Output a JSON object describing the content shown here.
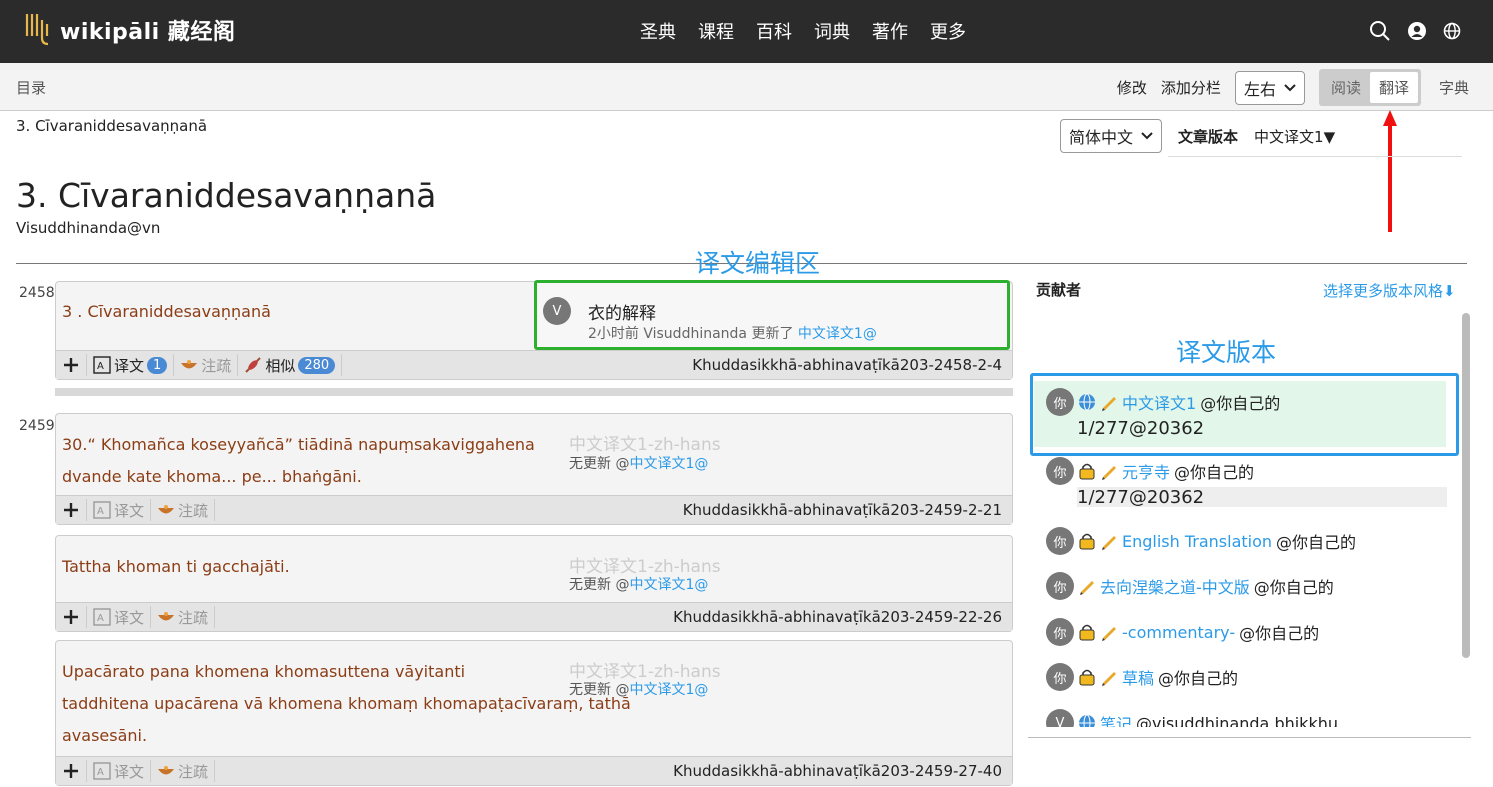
{
  "app": {
    "logo": "wikipāli 藏经阁",
    "nav": [
      "圣典",
      "课程",
      "百科",
      "词典",
      "著作",
      "更多"
    ]
  },
  "toolbar": {
    "toc": "目录",
    "edit": "修改",
    "add_column": "添加分栏",
    "layout": "左右",
    "mode_read": "阅读",
    "mode_translate": "翻译",
    "dict": "字典"
  },
  "page": {
    "crumb": "3. Cīvaraniddesavaṇṇanā",
    "lang": "简体中文",
    "version_label": "文章版本",
    "version_value": "中文译文1▼",
    "title": "3. Cīvaraniddesavaṇṇanā",
    "author": "Visuddhinanda@vn"
  },
  "annotations": {
    "edit_area": "译文编辑区",
    "versions": "译文版本"
  },
  "paragraphs": [
    {
      "num": "2458",
      "pali": "3 . Cīvaraniddesavaṇṇanā",
      "trans_avatar": "V",
      "trans_text": "衣的解释",
      "trans_meta": "2小时前 Visuddhinanda 更新了",
      "trans_link": "中文译文1@",
      "plus": "",
      "tr": "译文",
      "tr_count": "1",
      "note": "注疏",
      "sim": "相似",
      "sim_count": "280",
      "ref": "Khuddasikkhā-abhinavaṭīkā203-2458-2-4"
    },
    {
      "num": "2459",
      "pali1": "30.“ Khomañca koseyyañcā” tiādinā napuṃsakaviggahena",
      "pali2": "dvande kate khoma... pe... bhaṅgāni.",
      "ph": "中文译文1-zh-hans",
      "sub": "无更新 @",
      "sublink": "中文译文1@",
      "tr": "译文",
      "note": "注疏",
      "ref": "Khuddasikkhā-abhinavaṭīkā203-2459-2-21"
    },
    {
      "pali1": "Tattha khoman ti gacchajāti.",
      "ph": "中文译文1-zh-hans",
      "sub": "无更新 @",
      "sublink": "中文译文1@",
      "tr": "译文",
      "note": "注疏",
      "ref": "Khuddasikkhā-abhinavaṭīkā203-2459-22-26"
    },
    {
      "pali1": "Upacārato pana khomena khomasuttena vāyitanti",
      "pali2": "taddhitena upacārena vā khomena khomaṃ khomapaṭacīvaraṃ, tathā",
      "pali3": "avasesāni.",
      "ph": "中文译文1-zh-hans",
      "sub": "无更新 @",
      "sublink": "中文译文1@",
      "tr": "译文",
      "note": "注疏",
      "ref": "Khuddasikkhā-abhinavaṭīkā203-2459-27-40"
    }
  ],
  "contributors": {
    "title": "贡献者",
    "more": "选择更多版本风格⬇"
  },
  "versions": [
    {
      "avatar": "你",
      "name": "中文译文1",
      "owner": "@你自己的",
      "stat": "1/277@20362"
    },
    {
      "avatar": "你",
      "name": "元亨寺",
      "owner": "@你自己的",
      "stat": "1/277@20362"
    },
    {
      "avatar": "你",
      "name": "English Translation",
      "owner": "@你自己的"
    },
    {
      "avatar": "你",
      "name": "去向涅槃之道-中文版",
      "owner": "@你自己的"
    },
    {
      "avatar": "你",
      "name": "-commentary-",
      "owner": "@你自己的"
    },
    {
      "avatar": "你",
      "name": "草稿",
      "owner": "@你自己的"
    },
    {
      "avatar": "V",
      "name": "笔记",
      "owner": "@visuddhinanda bhikkhu"
    }
  ]
}
